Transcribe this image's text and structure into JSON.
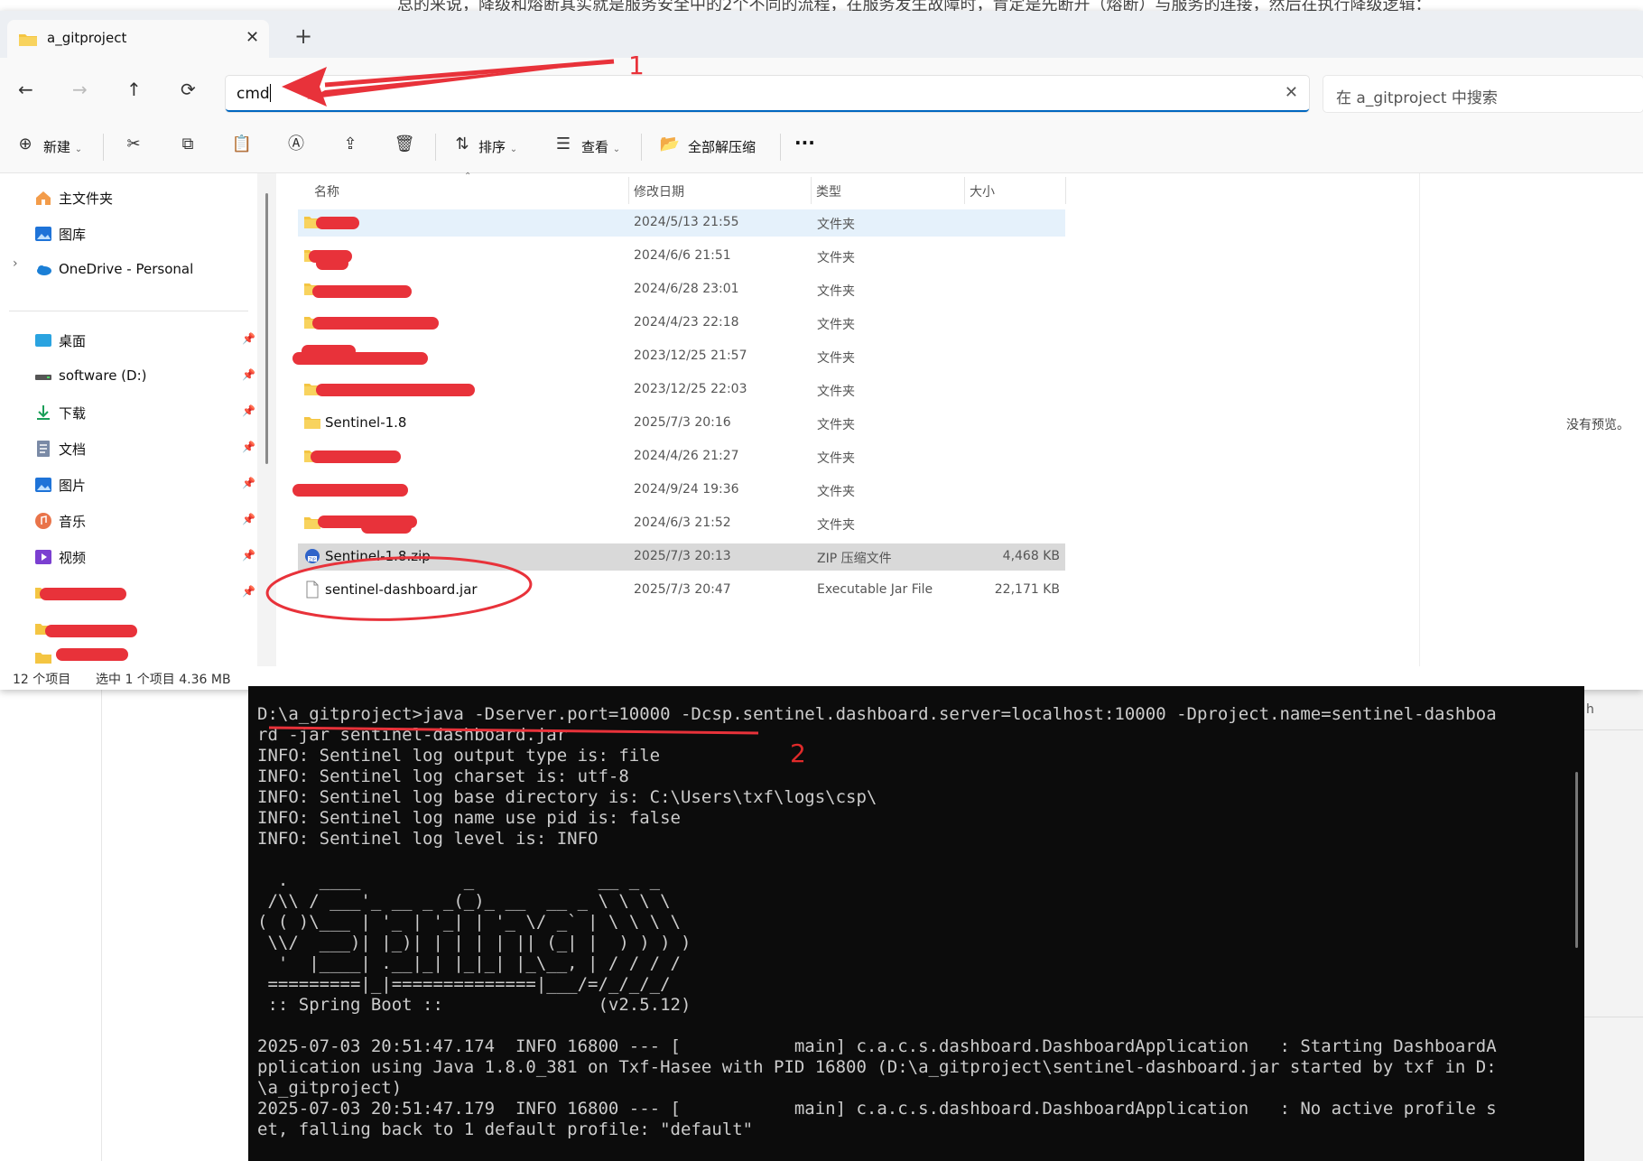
{
  "background_doc": {
    "top_text": "总的来说，降级和熔断其实就是服务安全中的2个不同的流程，在服务发生故障时，肯定是先断开（熔断）与服务的连接，然后在执行降级逻辑：",
    "right_letter": "h"
  },
  "explorer": {
    "tab": {
      "title": "a_gitproject",
      "close": "✕",
      "add": "+"
    },
    "nav": {
      "back": "←",
      "forward": "→",
      "up": "↑",
      "refresh": "⟳"
    },
    "address": {
      "value": "cmd",
      "clear": "✕"
    },
    "search": {
      "placeholder": "在 a_gitproject 中搜索"
    },
    "commands": {
      "new": "新建",
      "sort": "排序",
      "view": "查看",
      "extract_all": "全部解压缩",
      "more": "···"
    },
    "sidebar": {
      "home": "主文件夹",
      "gallery": "图库",
      "onedrive": "OneDrive - Personal",
      "desktop": "桌面",
      "software": "software (D:)",
      "downloads": "下载",
      "documents": "文档",
      "pictures": "图片",
      "music": "音乐",
      "videos": "视频"
    },
    "columns": {
      "name": "名称",
      "modified": "修改日期",
      "type": "类型",
      "size": "大小"
    },
    "rows": [
      {
        "name": "",
        "date": "2024/5/13 21:55",
        "type": "文件夹",
        "size": ""
      },
      {
        "name": "",
        "date": "2024/6/6 21:51",
        "type": "文件夹",
        "size": ""
      },
      {
        "name": "",
        "date": "2024/6/28 23:01",
        "type": "文件夹",
        "size": ""
      },
      {
        "name": "",
        "date": "2024/4/23 22:18",
        "type": "文件夹",
        "size": ""
      },
      {
        "name": "",
        "date": "2023/12/25 21:57",
        "type": "文件夹",
        "size": ""
      },
      {
        "name": "",
        "date": "2023/12/25 22:03",
        "type": "文件夹",
        "size": ""
      },
      {
        "name": "Sentinel-1.8",
        "date": "2025/7/3 20:16",
        "type": "文件夹",
        "size": ""
      },
      {
        "name": "",
        "date": "2024/4/26 21:27",
        "type": "文件夹",
        "size": ""
      },
      {
        "name": "",
        "date": "2024/9/24 19:36",
        "type": "文件夹",
        "size": ""
      },
      {
        "name": "",
        "date": "2024/6/3 21:52",
        "type": "文件夹",
        "size": ""
      },
      {
        "name": "Sentinel-1.8.zip",
        "date": "2025/7/3 20:13",
        "type": "ZIP 压缩文件",
        "size": "4,468 KB"
      },
      {
        "name": "sentinel-dashboard.jar",
        "date": "2025/7/3 20:47",
        "type": "Executable Jar File",
        "size": "22,171 KB"
      }
    ],
    "preview": "没有预览。",
    "status": {
      "count": "12 个项目",
      "selected": "选中 1 个项目  4.36 MB"
    }
  },
  "annotations": {
    "label1": "1",
    "label2": "2"
  },
  "terminal": {
    "lines": [
      "D:\\a_gitproject>java -Dserver.port=10000 -Dcsp.sentinel.dashboard.server=localhost:10000 -Dproject.name=sentinel-dashboa",
      "rd -jar sentinel-dashboard.jar",
      "INFO: Sentinel log output type is: file",
      "INFO: Sentinel log charset is: utf-8",
      "INFO: Sentinel log base directory is: C:\\Users\\txf\\logs\\csp\\",
      "INFO: Sentinel log name use pid is: false",
      "INFO: Sentinel log level is: INFO",
      "",
      "  .   ____          _            __ _ _",
      " /\\\\ / ___'_ __ _ _(_)_ __  __ _ \\ \\ \\ \\",
      "( ( )\\___ | '_ | '_| | '_ \\/ _` | \\ \\ \\ \\",
      " \\\\/  ___)| |_)| | | | | || (_| |  ) ) ) )",
      "  '  |____| .__|_| |_|_| |_\\__, | / / / /",
      " =========|_|==============|___/=/_/_/_/",
      " :: Spring Boot ::               (v2.5.12)",
      "",
      "2025-07-03 20:51:47.174  INFO 16800 --- [           main] c.a.c.s.dashboard.DashboardApplication   : Starting DashboardA",
      "pplication using Java 1.8.0_381 on Txf-Hasee with PID 16800 (D:\\a_gitproject\\sentinel-dashboard.jar started by txf in D:",
      "\\a_gitproject)",
      "2025-07-03 20:51:47.179  INFO 16800 --- [           main] c.a.c.s.dashboard.DashboardApplication   : No active profile s",
      "et, falling back to 1 default profile: \"default\""
    ]
  },
  "colors": {
    "accent": "#0067c0",
    "annotation_red": "#e8323a",
    "terminal_bg": "#0c0c0c",
    "terminal_fg": "#cccccc",
    "folder": "#f4c542"
  }
}
